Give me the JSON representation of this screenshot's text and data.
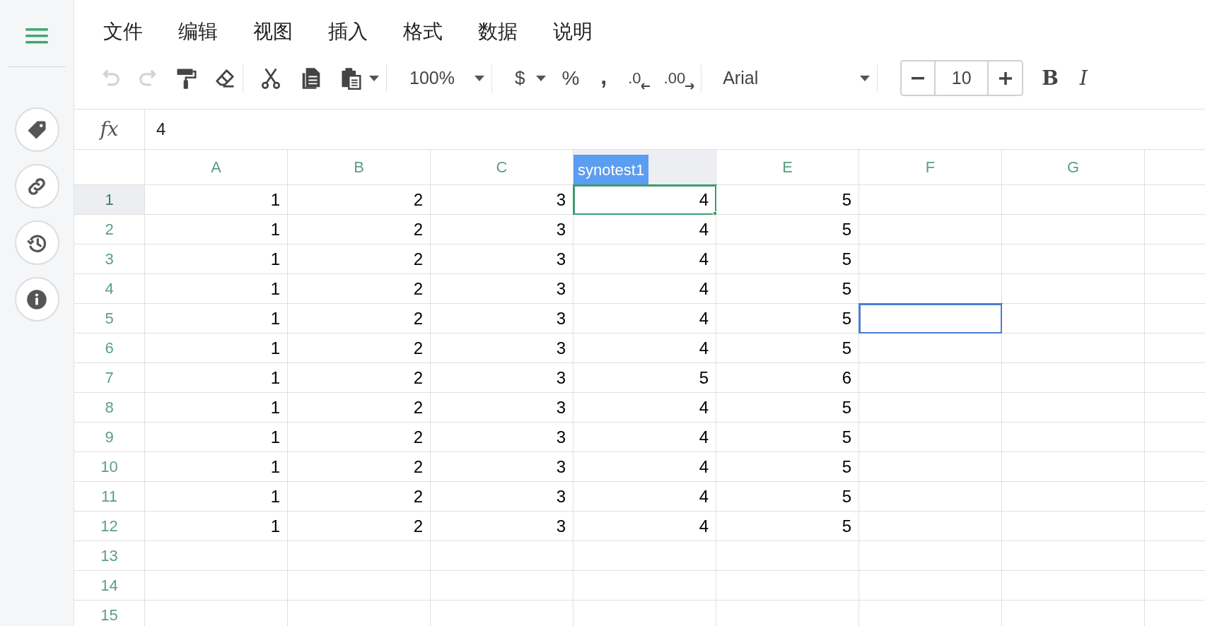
{
  "menu": [
    {
      "label": "文件"
    },
    {
      "label": "编辑"
    },
    {
      "label": "视图"
    },
    {
      "label": "插入"
    },
    {
      "label": "格式"
    },
    {
      "label": "数据"
    },
    {
      "label": "说明"
    }
  ],
  "toolbar": {
    "undo": {
      "disabled": true
    },
    "redo": {
      "disabled": true
    },
    "zoom": "100%",
    "currency": "$",
    "percent": "%",
    "comma": ",",
    "decrease_decimals": ".0",
    "increase_decimals": ".00",
    "font": "Arial",
    "font_size": "10",
    "bold": "B",
    "italic": "I"
  },
  "formula_bar": {
    "label": "fx",
    "value": "4"
  },
  "columns": [
    {
      "label": "A",
      "selected": false
    },
    {
      "label": "B",
      "selected": false
    },
    {
      "label": "C",
      "selected": false
    },
    {
      "collaborator_tag": "synotest1",
      "selected": true
    },
    {
      "label": "E",
      "selected": false
    },
    {
      "label": "F",
      "selected": false
    },
    {
      "label": "G",
      "selected": false
    }
  ],
  "rows": [
    {
      "number": "1",
      "selected": true,
      "cells": [
        {
          "value": "1",
          "selected": false,
          "collaborator": false
        },
        {
          "value": "2",
          "selected": false,
          "collaborator": false
        },
        {
          "value": "3",
          "selected": false,
          "collaborator": false
        },
        {
          "value": "4",
          "selected": true,
          "collaborator": false
        },
        {
          "value": "5",
          "selected": false,
          "collaborator": false
        },
        {
          "selected": false,
          "collaborator": false
        },
        {
          "selected": false,
          "collaborator": false
        }
      ]
    },
    {
      "number": "2",
      "selected": false,
      "cells": [
        {
          "value": "1",
          "selected": false,
          "collaborator": false
        },
        {
          "value": "2",
          "selected": false,
          "collaborator": false
        },
        {
          "value": "3",
          "selected": false,
          "collaborator": false
        },
        {
          "value": "4",
          "selected": false,
          "collaborator": false
        },
        {
          "value": "5",
          "selected": false,
          "collaborator": false
        },
        {
          "selected": false,
          "collaborator": false
        },
        {
          "selected": false,
          "collaborator": false
        }
      ]
    },
    {
      "number": "3",
      "selected": false,
      "cells": [
        {
          "value": "1",
          "selected": false,
          "collaborator": false
        },
        {
          "value": "2",
          "selected": false,
          "collaborator": false
        },
        {
          "value": "3",
          "selected": false,
          "collaborator": false
        },
        {
          "value": "4",
          "selected": false,
          "collaborator": false
        },
        {
          "value": "5",
          "selected": false,
          "collaborator": false
        },
        {
          "selected": false,
          "collaborator": false
        },
        {
          "selected": false,
          "collaborator": false
        }
      ]
    },
    {
      "number": "4",
      "selected": false,
      "cells": [
        {
          "value": "1",
          "selected": false,
          "collaborator": false
        },
        {
          "value": "2",
          "selected": false,
          "collaborator": false
        },
        {
          "value": "3",
          "selected": false,
          "collaborator": false
        },
        {
          "value": "4",
          "selected": false,
          "collaborator": false
        },
        {
          "value": "5",
          "selected": false,
          "collaborator": false
        },
        {
          "selected": false,
          "collaborator": false
        },
        {
          "selected": false,
          "collaborator": false
        }
      ]
    },
    {
      "number": "5",
      "selected": false,
      "cells": [
        {
          "value": "1",
          "selected": false,
          "collaborator": false
        },
        {
          "value": "2",
          "selected": false,
          "collaborator": false
        },
        {
          "value": "3",
          "selected": false,
          "collaborator": false
        },
        {
          "value": "4",
          "selected": false,
          "collaborator": false
        },
        {
          "value": "5",
          "selected": false,
          "collaborator": false
        },
        {
          "selected": false,
          "collaborator": true
        },
        {
          "selected": false,
          "collaborator": false
        }
      ]
    },
    {
      "number": "6",
      "selected": false,
      "cells": [
        {
          "value": "1",
          "selected": false,
          "collaborator": false
        },
        {
          "value": "2",
          "selected": false,
          "collaborator": false
        },
        {
          "value": "3",
          "selected": false,
          "collaborator": false
        },
        {
          "value": "4",
          "selected": false,
          "collaborator": false
        },
        {
          "value": "5",
          "selected": false,
          "collaborator": false
        },
        {
          "selected": false,
          "collaborator": false
        },
        {
          "selected": false,
          "collaborator": false
        }
      ]
    },
    {
      "number": "7",
      "selected": false,
      "cells": [
        {
          "value": "1",
          "selected": false,
          "collaborator": false
        },
        {
          "value": "2",
          "selected": false,
          "collaborator": false
        },
        {
          "value": "3",
          "selected": false,
          "collaborator": false
        },
        {
          "value": "5",
          "selected": false,
          "collaborator": false
        },
        {
          "value": "6",
          "selected": false,
          "collaborator": false
        },
        {
          "selected": false,
          "collaborator": false
        },
        {
          "selected": false,
          "collaborator": false
        }
      ]
    },
    {
      "number": "8",
      "selected": false,
      "cells": [
        {
          "value": "1",
          "selected": false,
          "collaborator": false
        },
        {
          "value": "2",
          "selected": false,
          "collaborator": false
        },
        {
          "value": "3",
          "selected": false,
          "collaborator": false
        },
        {
          "value": "4",
          "selected": false,
          "collaborator": false
        },
        {
          "value": "5",
          "selected": false,
          "collaborator": false
        },
        {
          "selected": false,
          "collaborator": false
        },
        {
          "selected": false,
          "collaborator": false
        }
      ]
    },
    {
      "number": "9",
      "selected": false,
      "cells": [
        {
          "value": "1",
          "selected": false,
          "collaborator": false
        },
        {
          "value": "2",
          "selected": false,
          "collaborator": false
        },
        {
          "value": "3",
          "selected": false,
          "collaborator": false
        },
        {
          "value": "4",
          "selected": false,
          "collaborator": false
        },
        {
          "value": "5",
          "selected": false,
          "collaborator": false
        },
        {
          "selected": false,
          "collaborator": false
        },
        {
          "selected": false,
          "collaborator": false
        }
      ]
    },
    {
      "number": "10",
      "selected": false,
      "cells": [
        {
          "value": "1",
          "selected": false,
          "collaborator": false
        },
        {
          "value": "2",
          "selected": false,
          "collaborator": false
        },
        {
          "value": "3",
          "selected": false,
          "collaborator": false
        },
        {
          "value": "4",
          "selected": false,
          "collaborator": false
        },
        {
          "value": "5",
          "selected": false,
          "collaborator": false
        },
        {
          "selected": false,
          "collaborator": false
        },
        {
          "selected": false,
          "collaborator": false
        }
      ]
    },
    {
      "number": "11",
      "selected": false,
      "cells": [
        {
          "value": "1",
          "selected": false,
          "collaborator": false
        },
        {
          "value": "2",
          "selected": false,
          "collaborator": false
        },
        {
          "value": "3",
          "selected": false,
          "collaborator": false
        },
        {
          "value": "4",
          "selected": false,
          "collaborator": false
        },
        {
          "value": "5",
          "selected": false,
          "collaborator": false
        },
        {
          "selected": false,
          "collaborator": false
        },
        {
          "selected": false,
          "collaborator": false
        }
      ]
    },
    {
      "number": "12",
      "selected": false,
      "cells": [
        {
          "value": "1",
          "selected": false,
          "collaborator": false
        },
        {
          "value": "2",
          "selected": false,
          "collaborator": false
        },
        {
          "value": "3",
          "selected": false,
          "collaborator": false
        },
        {
          "value": "4",
          "selected": false,
          "collaborator": false
        },
        {
          "value": "5",
          "selected": false,
          "collaborator": false
        },
        {
          "selected": false,
          "collaborator": false
        },
        {
          "selected": false,
          "collaborator": false
        }
      ]
    },
    {
      "number": "13",
      "selected": false
    },
    {
      "number": "14",
      "selected": false
    },
    {
      "number": "15",
      "selected": false
    }
  ]
}
